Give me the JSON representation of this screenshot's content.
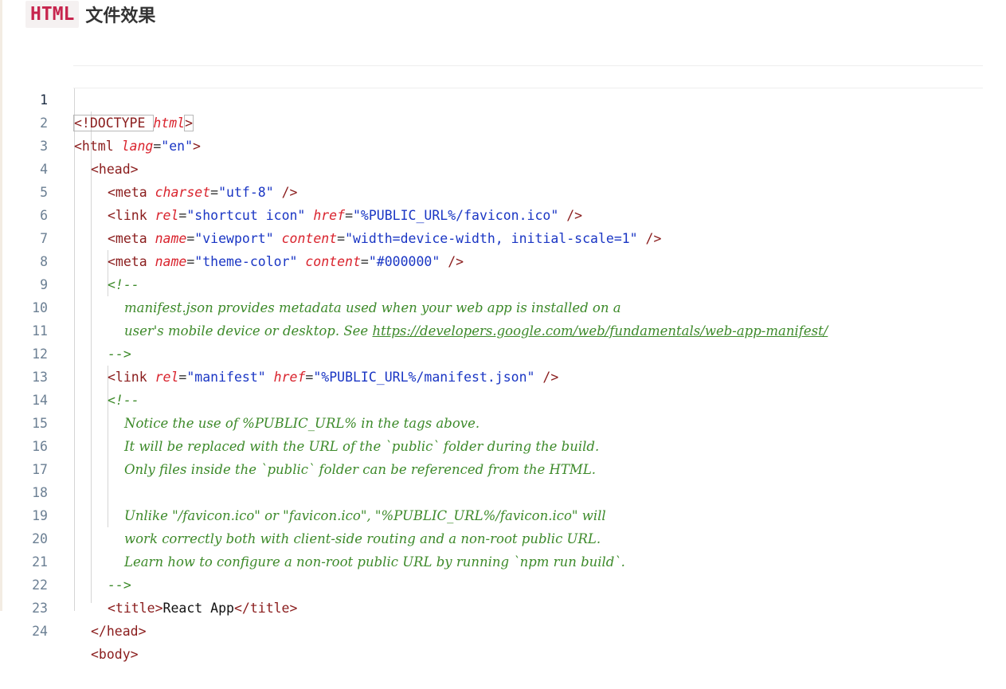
{
  "heading": {
    "code": "HTML",
    "text": "文件效果"
  },
  "editor": {
    "active_line": 1,
    "lines": [
      {
        "n": "1"
      },
      {
        "n": "2"
      },
      {
        "n": "3"
      },
      {
        "n": "4"
      },
      {
        "n": "5"
      },
      {
        "n": "6"
      },
      {
        "n": "7"
      },
      {
        "n": "8"
      },
      {
        "n": "9"
      },
      {
        "n": "10"
      },
      {
        "n": "11"
      },
      {
        "n": "12"
      },
      {
        "n": "13"
      },
      {
        "n": "14"
      },
      {
        "n": "15"
      },
      {
        "n": "16"
      },
      {
        "n": "17"
      },
      {
        "n": "18"
      },
      {
        "n": "19"
      },
      {
        "n": "20"
      },
      {
        "n": "21"
      },
      {
        "n": "22"
      },
      {
        "n": "23"
      },
      {
        "n": "24"
      }
    ],
    "code": {
      "doctype_open": "<!DOCTYPE ",
      "doctype_attr": "html",
      "doctype_close": ">",
      "html_open": "<html ",
      "lang_attr": "lang",
      "lang_val": "\"en\"",
      "head_open": "<head>",
      "meta": "<meta ",
      "charset_attr": "charset",
      "charset_val": "\"utf-8\"",
      "selfclose": " />",
      "link": "<link ",
      "rel_attr": "rel",
      "rel_icon_val": "\"shortcut icon\"",
      "href_attr": "href",
      "href_icon_val": "\"%PUBLIC_URL%/favicon.ico\"",
      "name_attr": "name",
      "viewport_val": "\"viewport\"",
      "content_attr": "content",
      "viewport_content_val": "\"width=device-width, initial-scale=1\"",
      "theme_val": "\"theme-color\"",
      "theme_content_val": "\"#000000\"",
      "comment_open": "<!--",
      "comment_close": "-->",
      "c9": "manifest.json provides metadata used when your web app is installed on a",
      "c10_text": "user's mobile device or desktop. See ",
      "c10_link": "https://developers.google.com/web/fundamentals/web-app-manifest/",
      "rel_manifest_val": "\"manifest\"",
      "href_manifest_val": "\"%PUBLIC_URL%/manifest.json\"",
      "c14": "Notice the use of %PUBLIC_URL% in the tags above.",
      "c15": "It will be replaced with the URL of the `public` folder during the build.",
      "c16": "Only files inside the `public` folder can be referenced from the HTML.",
      "c18": "Unlike \"/favicon.ico\" or \"favicon.ico\", \"%PUBLIC_URL%/favicon.ico\" will",
      "c19": "work correctly both with client-side routing and a non-root public URL.",
      "c20": "Learn how to configure a non-root public URL by running `npm run build`.",
      "title_open": "<title>",
      "title_text": "React App",
      "title_close": "</title>",
      "head_close": "</head>",
      "body_open": "<body>",
      "eq": "=",
      "gt": ">"
    }
  }
}
